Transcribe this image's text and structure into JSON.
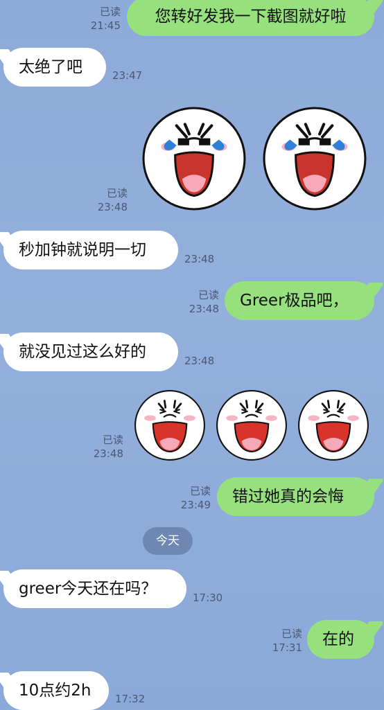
{
  "messages": [
    {
      "id": "m1",
      "text": "您转好发我一下截图就好啦",
      "read": "已读",
      "time": "21:45"
    },
    {
      "id": "m2",
      "text": "太绝了吧",
      "time": "23:47"
    },
    {
      "id": "m3",
      "read": "已读",
      "time": "23:48",
      "sticker_icon": "crying-laughing-face-icon"
    },
    {
      "id": "m4",
      "text": "秒加钟就说明一切",
      "time": "23:48"
    },
    {
      "id": "m5",
      "text": "Greer极品吧，",
      "read": "已读",
      "time": "23:48"
    },
    {
      "id": "m6",
      "text": "就没见过这么好的",
      "time": "23:48"
    },
    {
      "id": "m7",
      "read": "已读",
      "time": "23:48",
      "sticker_icon": "laughing-face-icon"
    },
    {
      "id": "m8",
      "text": "错过她真的会悔",
      "read": "已读",
      "time": "23:49"
    },
    {
      "id": "m9",
      "text": "greer今天还在吗？",
      "time": "17:30"
    },
    {
      "id": "m10",
      "text": "在的",
      "read": "已读",
      "time": "17:31"
    },
    {
      "id": "m11",
      "text": "10点约2h",
      "time": "17:32"
    }
  ],
  "date_separator": "今天",
  "colors": {
    "background": "#8eaad8",
    "incoming_bubble": "#ffffff",
    "outgoing_bubble": "#96e07e",
    "meta_text": "#4a5874",
    "date_pill": "#6f88b3"
  }
}
